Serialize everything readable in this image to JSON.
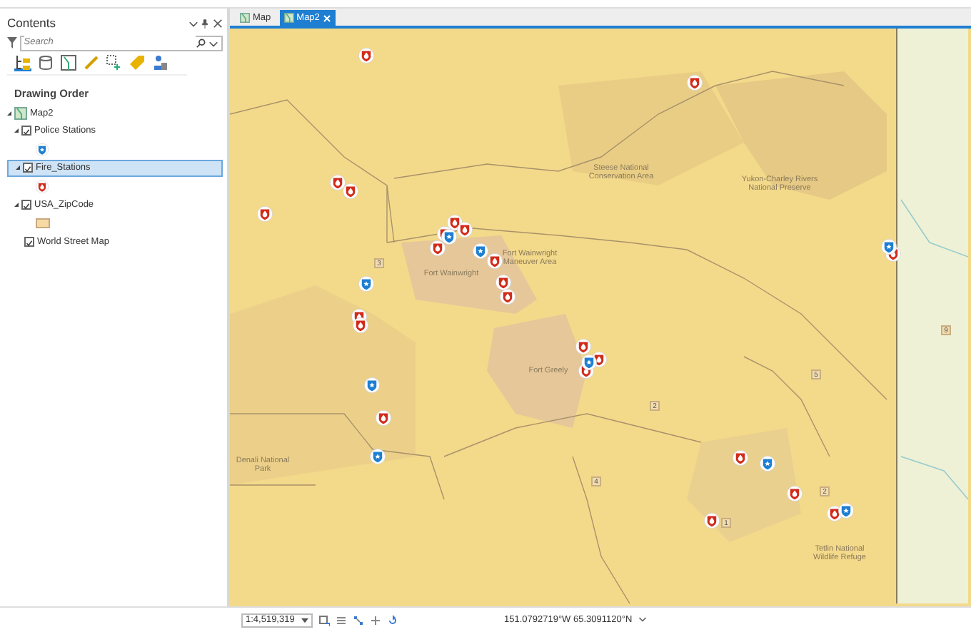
{
  "contents": {
    "title": "Contents",
    "search": {
      "placeholder": "Search"
    },
    "heading": "Drawing Order",
    "tree": [
      {
        "label": "Map2",
        "kind": "map",
        "expanded": true,
        "children": [
          {
            "label": "Police Stations",
            "legend": {
              "kind": "police"
            },
            "checked": true,
            "expanded": true,
            "selected": false
          },
          {
            "label": "Fire_Stations",
            "legend": {
              "kind": "fire"
            },
            "checked": true,
            "expanded": true,
            "selected": true
          },
          {
            "label": "USA_ZipCode",
            "legend": {
              "kind": "polygon"
            },
            "checked": true,
            "expanded": true,
            "selected": false
          },
          {
            "label": "World Street Map",
            "checked": true,
            "selected": false
          }
        ]
      }
    ]
  },
  "view_tabs": [
    {
      "label": "Map",
      "selected": false
    },
    {
      "label": "Map2",
      "selected": true
    }
  ],
  "map": {
    "labels": [
      "Steese National Conservation Area",
      "Yukon-Charley Rivers National Preserve",
      "Fort Wainwright",
      "Fort Wainwright Maneuver Area",
      "Fort Greely",
      "Denali National Park",
      "Tetlin National Wildlife Refuge"
    ],
    "route_shields": [
      "3",
      "2",
      "5",
      "4",
      "1",
      "2",
      "9"
    ]
  },
  "status_bar": {
    "scale": "1:4,519,319",
    "coordinates": "151.0792719°W 65.3091120°N"
  }
}
